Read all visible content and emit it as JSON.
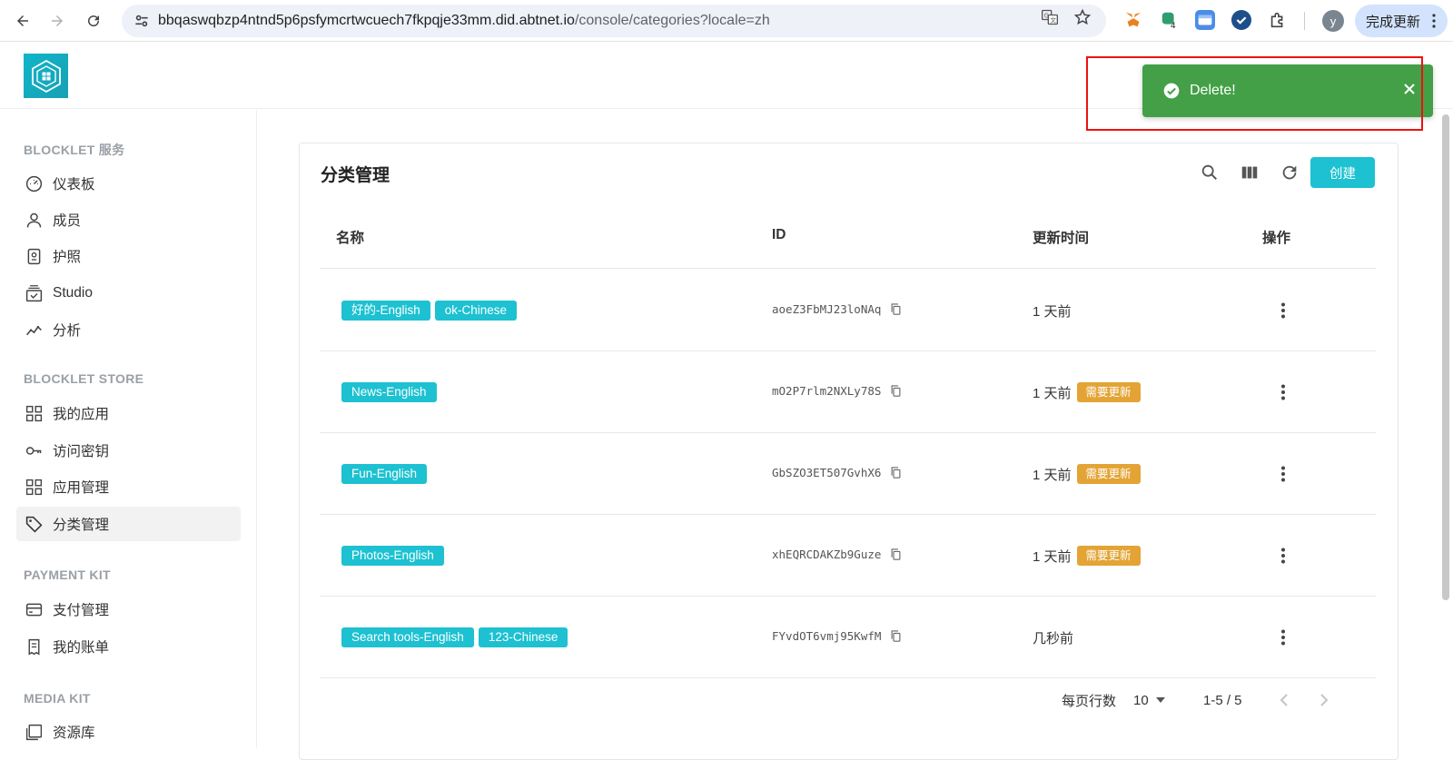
{
  "browser": {
    "url_host": "bbqaswqbzp4ntnd5p6psfymcrtwcuech7fkpqje33mm.did.abtnet.io",
    "url_path": "/console/categories?locale=zh",
    "profile_initial": "y",
    "update_label": "完成更新",
    "extension_badge": "4"
  },
  "sidebar": {
    "sections": [
      {
        "title": "BLOCKLET 服务"
      },
      {
        "title": "BLOCKLET STORE"
      },
      {
        "title": "PAYMENT KIT"
      },
      {
        "title": "MEDIA KIT"
      }
    ],
    "items": [
      {
        "label": "仪表板",
        "icon": "dashboard-icon"
      },
      {
        "label": "成员",
        "icon": "person-icon"
      },
      {
        "label": "护照",
        "icon": "passport-icon"
      },
      {
        "label": "Studio",
        "icon": "studio-icon"
      },
      {
        "label": "分析",
        "icon": "analytics-icon"
      },
      {
        "label": "我的应用",
        "icon": "grid-icon"
      },
      {
        "label": "访问密钥",
        "icon": "key-icon"
      },
      {
        "label": "应用管理",
        "icon": "grid-icon"
      },
      {
        "label": "分类管理",
        "icon": "tag-icon",
        "active": true
      },
      {
        "label": "支付管理",
        "icon": "card-icon"
      },
      {
        "label": "我的账单",
        "icon": "receipt-icon"
      },
      {
        "label": "资源库",
        "icon": "library-icon"
      }
    ]
  },
  "main": {
    "title": "分类管理",
    "create_label": "创建",
    "columns": {
      "name": "名称",
      "id": "ID",
      "updated": "更新时间",
      "actions": "操作"
    },
    "rows": [
      {
        "tags": [
          "好的-English",
          "ok-Chinese"
        ],
        "id": "aoeZ3FbMJ23loNAq",
        "updated": "1 天前",
        "badge": ""
      },
      {
        "tags": [
          "News-English"
        ],
        "id": "mO2P7rlm2NXLy78S",
        "updated": "1 天前",
        "badge": "需要更新"
      },
      {
        "tags": [
          "Fun-English"
        ],
        "id": "GbSZO3ET507GvhX6",
        "updated": "1 天前",
        "badge": "需要更新"
      },
      {
        "tags": [
          "Photos-English"
        ],
        "id": "xhEQRCDAKZb9Guze",
        "updated": "1 天前",
        "badge": "需要更新"
      },
      {
        "tags": [
          "Search tools-English",
          "123-Chinese"
        ],
        "id": "FYvdOT6vmj95KwfM",
        "updated": "几秒前",
        "badge": ""
      }
    ],
    "pagination": {
      "rows_per_page_label": "每页行数",
      "rows_per_page": "10",
      "range": "1-5 / 5"
    }
  },
  "toast": {
    "message": "Delete!"
  },
  "colors": {
    "accent": "#1dc1d1",
    "toast": "#43a047",
    "badge": "#e3a435",
    "highlight": "#e11111"
  }
}
